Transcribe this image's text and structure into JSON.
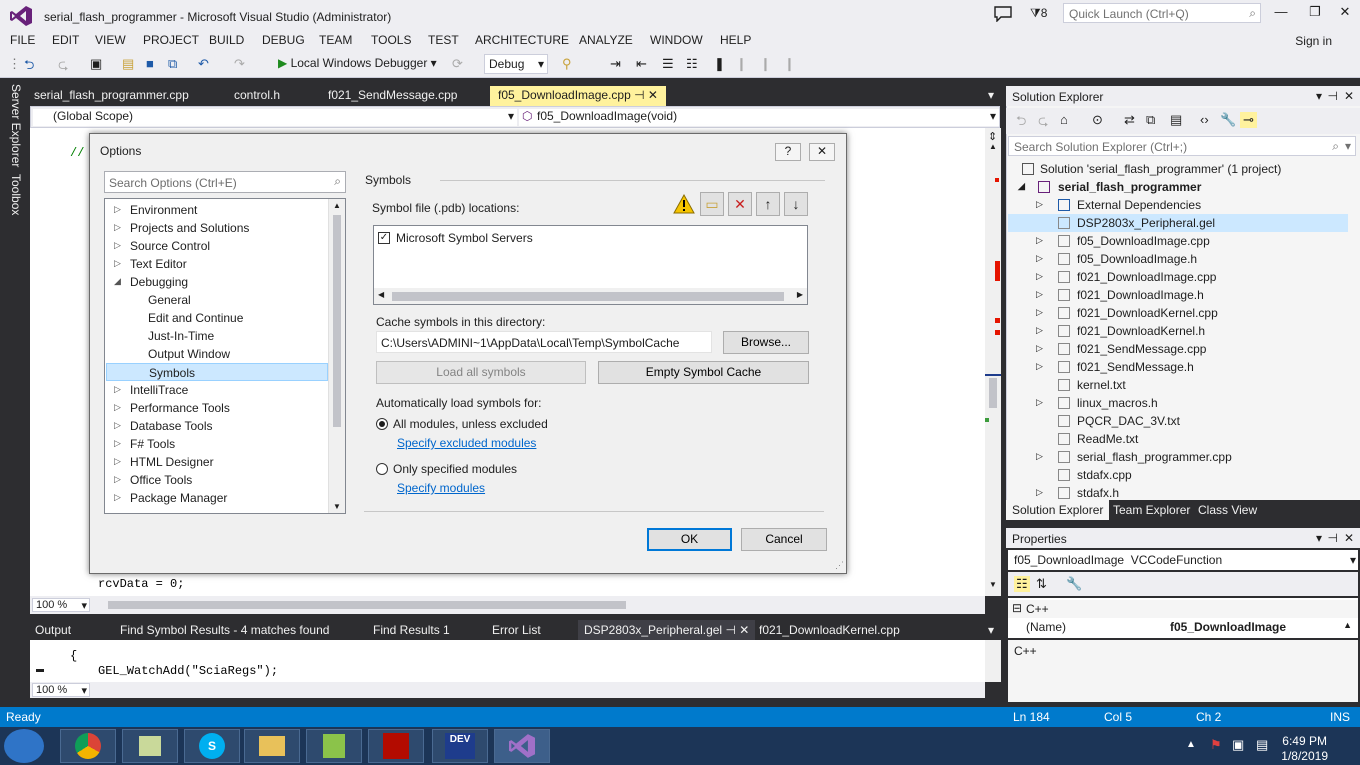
{
  "window": {
    "title": "serial_flash_programmer - Microsoft Visual Studio (Administrator)",
    "notification_count": "8",
    "quick_launch_placeholder": "Quick Launch (Ctrl+Q)"
  },
  "menu": {
    "items": [
      "FILE",
      "EDIT",
      "VIEW",
      "PROJECT",
      "BUILD",
      "DEBUG",
      "TEAM",
      "TOOLS",
      "TEST",
      "ARCHITECTURE",
      "ANALYZE",
      "WINDOW",
      "HELP"
    ],
    "sign_in": "Sign in"
  },
  "toolbar": {
    "debugger": "Local Windows Debugger",
    "configuration": "Debug"
  },
  "side_tabs": [
    "Server Explorer",
    "Toolbox"
  ],
  "doc_tabs": [
    "serial_flash_programmer.cpp",
    "control.h",
    "f021_SendMessage.cpp",
    "f05_DownloadImage.cpp"
  ],
  "nav": {
    "scope": "(Global Scope)",
    "function": "f05_DownloadImage(void)"
  },
  "editor": {
    "comment_prefix": "//",
    "line_bottom": "rcvData = 0;",
    "zoom": "100 %"
  },
  "bottom_tabs": [
    "Output",
    "Find Symbol Results - 4 matches found",
    "Find Results 1",
    "Error List",
    "DSP2803x_Peripheral.gel",
    "f021_DownloadKernel.cpp"
  ],
  "bottom_editor": {
    "line1": "{",
    "line2": "GEL_WatchAdd(\"SciaRegs\");",
    "zoom": "100 %"
  },
  "status": {
    "ready": "Ready",
    "line": "Ln 184",
    "col": "Col 5",
    "ch": "Ch 2",
    "ins": "INS"
  },
  "clock": {
    "time": "6:49 PM",
    "date": "1/8/2019"
  },
  "solution_explorer": {
    "title": "Solution Explorer",
    "search_placeholder": "Search Solution Explorer (Ctrl+;)",
    "solution": "Solution 'serial_flash_programmer' (1 project)",
    "project": "serial_flash_programmer",
    "items": [
      "External Dependencies",
      "DSP2803x_Peripheral.gel",
      "f05_DownloadImage.cpp",
      "f05_DownloadImage.h",
      "f021_DownloadImage.cpp",
      "f021_DownloadImage.h",
      "f021_DownloadKernel.cpp",
      "f021_DownloadKernel.h",
      "f021_SendMessage.cpp",
      "f021_SendMessage.h",
      "kernel.txt",
      "linux_macros.h",
      "PQCR_DAC_3V.txt",
      "ReadMe.txt",
      "serial_flash_programmer.cpp",
      "stdafx.cpp",
      "stdafx.h"
    ],
    "tabs": [
      "Solution Explorer",
      "Team Explorer",
      "Class View"
    ]
  },
  "properties": {
    "title": "Properties",
    "object": "f05_DownloadImage",
    "object_type": "VCCodeFunction",
    "category": "C++",
    "prop_name": "(Name)",
    "prop_value": "f05_DownloadImage",
    "description": "C++"
  },
  "dialog": {
    "title": "Options",
    "search_placeholder": "Search Options (Ctrl+E)",
    "tree": [
      "Environment",
      "Projects and Solutions",
      "Source Control",
      "Text Editor",
      "Debugging",
      "General",
      "Edit and Continue",
      "Just-In-Time",
      "Output Window",
      "Symbols",
      "IntelliTrace",
      "Performance Tools",
      "Database Tools",
      "F# Tools",
      "HTML Designer",
      "Office Tools",
      "Package Manager"
    ],
    "section": "Symbols",
    "symbol_locations_label": "Symbol file (.pdb) locations:",
    "symbol_server": "Microsoft Symbol Servers",
    "cache_label": "Cache symbols in this directory:",
    "cache_path": "C:\\Users\\ADMINI~1\\AppData\\Local\\Temp\\SymbolCache",
    "browse": "Browse...",
    "load_all": "Load all symbols",
    "empty_cache": "Empty Symbol Cache",
    "auto_load_label": "Automatically load symbols for:",
    "radio_all": "All modules, unless excluded",
    "link_excluded": "Specify excluded modules",
    "radio_only": "Only specified modules",
    "link_modules": "Specify modules",
    "ok": "OK",
    "cancel": "Cancel"
  }
}
